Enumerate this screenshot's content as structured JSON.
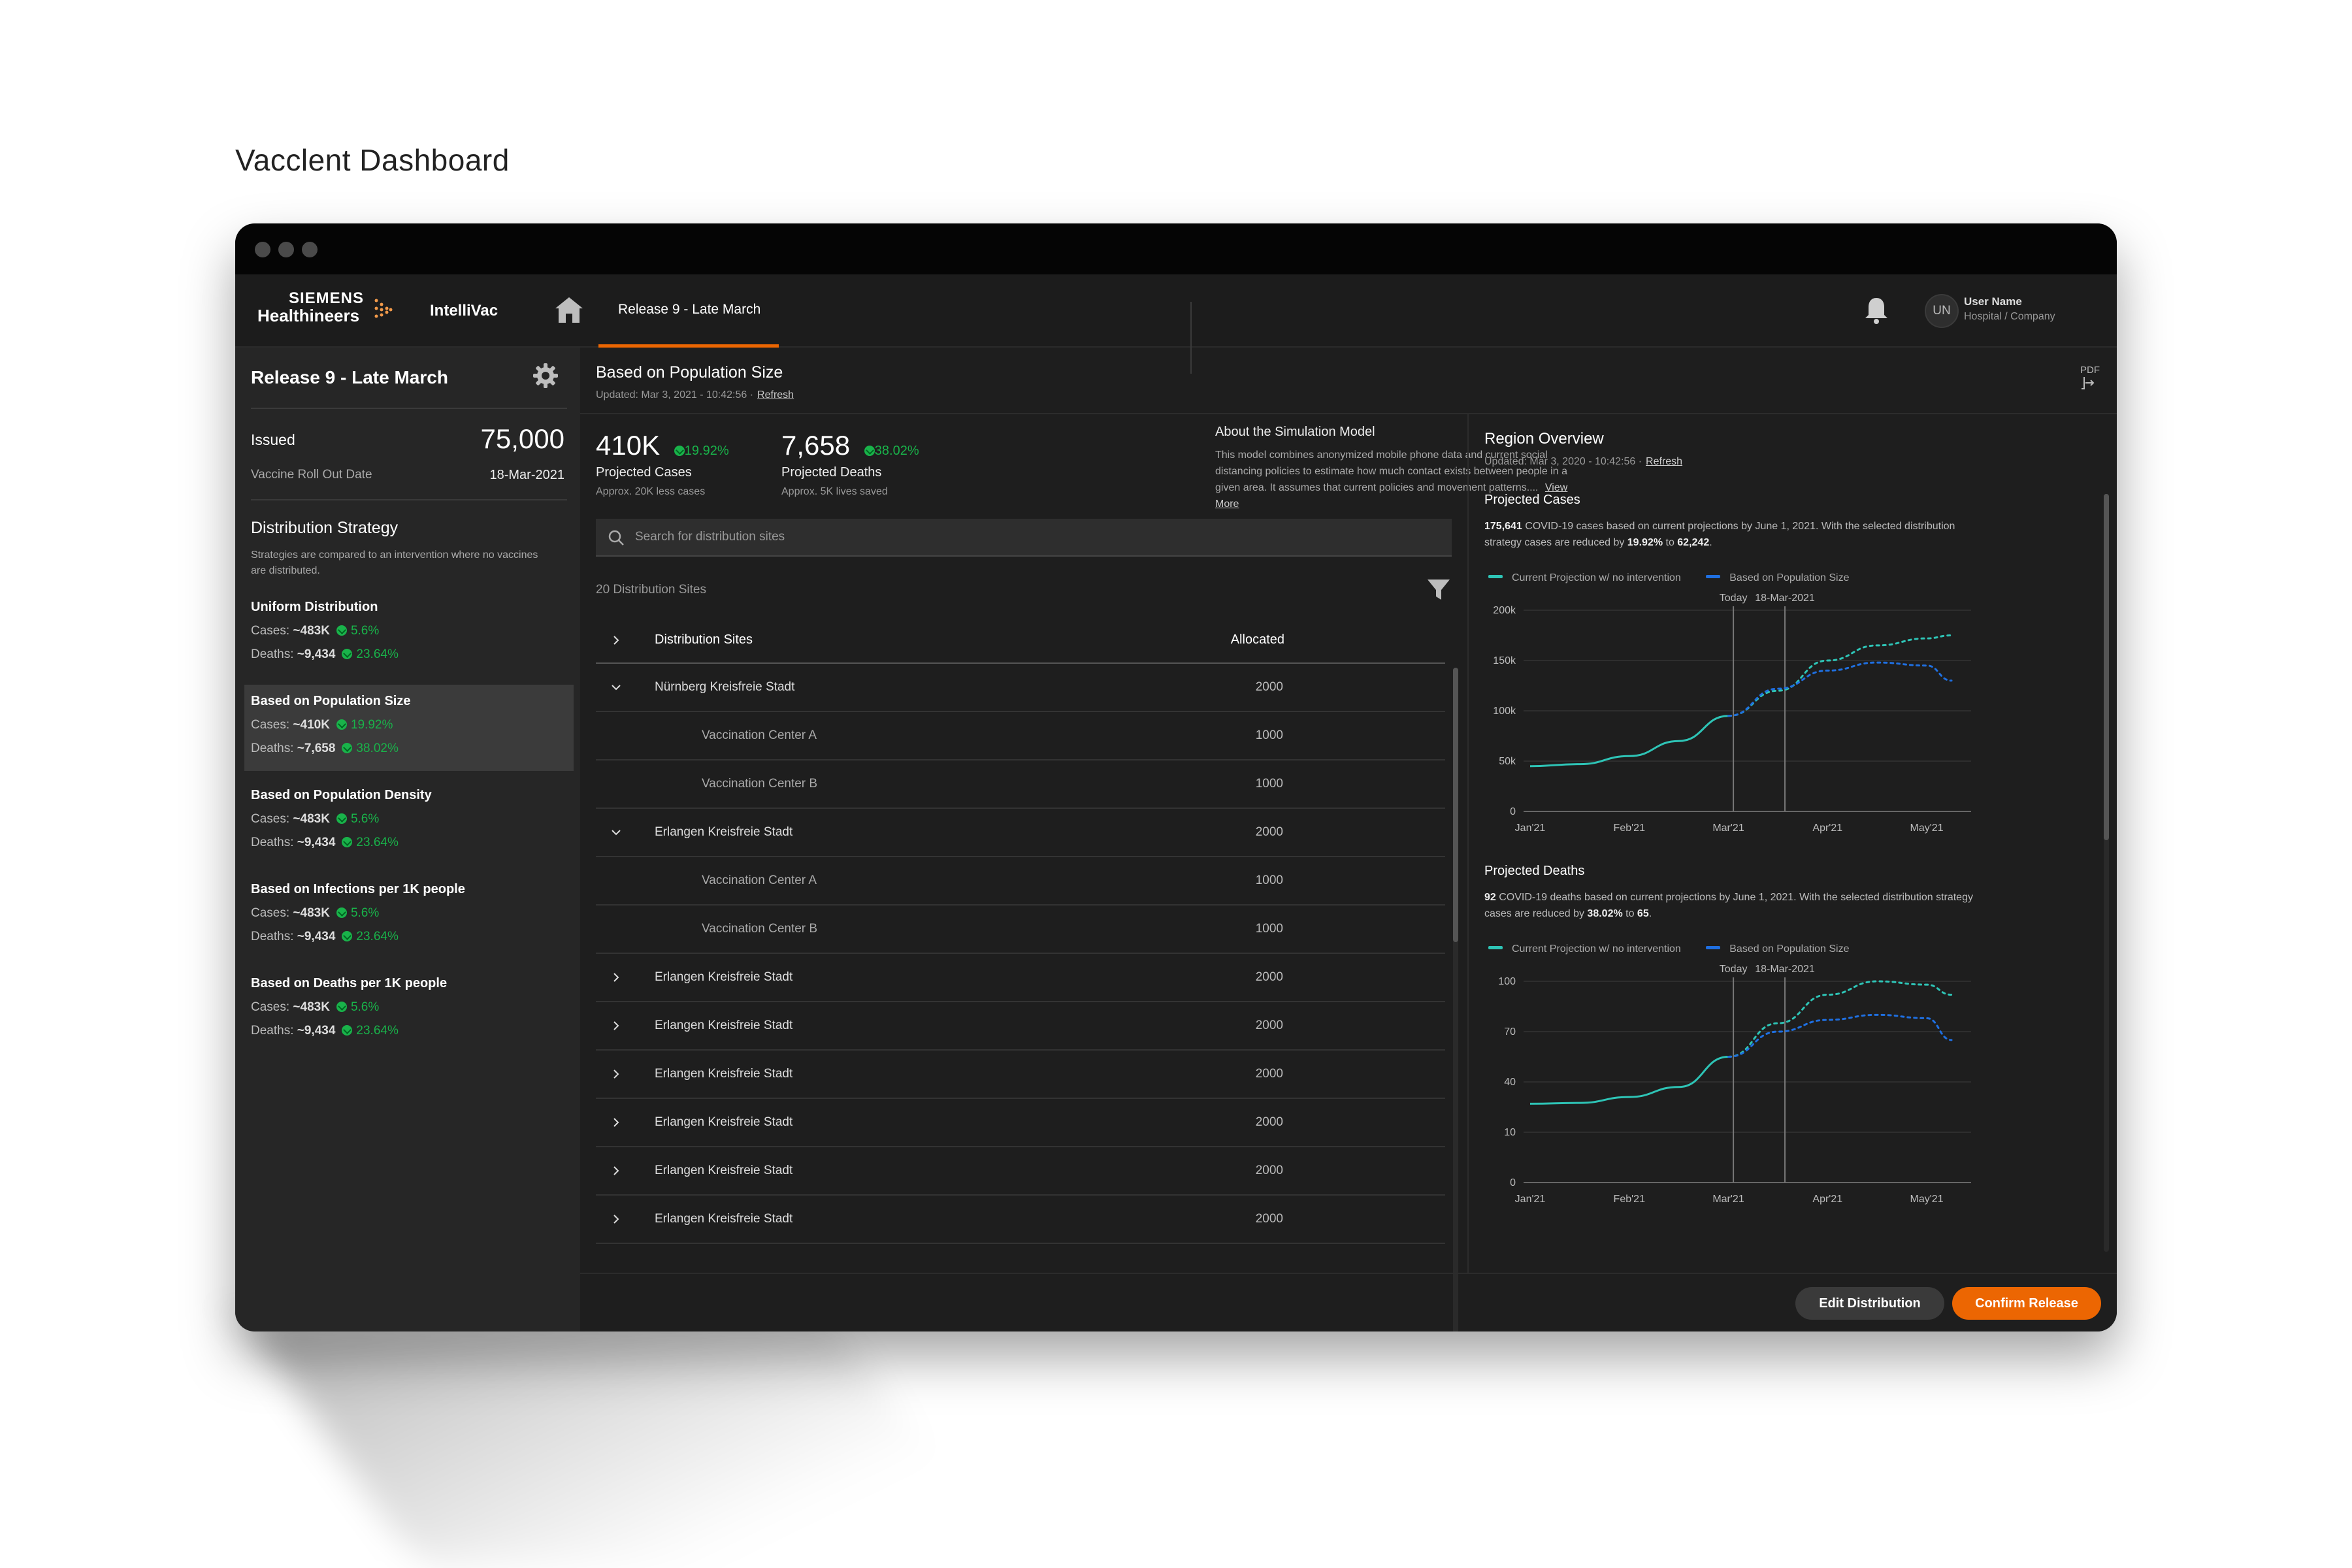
{
  "page_title": "Vacclent Dashboard",
  "nav": {
    "brand_line1": "SIEMENS",
    "brand_line2": "Healthineers",
    "product": "IntelliVac",
    "active_tab": "Release 9 - Late March",
    "user_initials": "UN",
    "user_name": "User Name",
    "user_org": "Hospital / Company",
    "accent_color": "#ec6602"
  },
  "sidebar": {
    "title": "Release 9 - Late March",
    "issued_label": "Issued",
    "issued_value": "75,000",
    "rollout_label": "Vaccine Roll Out Date",
    "rollout_value": "18-Mar-2021",
    "strategy_title": "Distribution Strategy",
    "strategy_desc": "Strategies are compared to an intervention where no vaccines are distributed.",
    "strategies": [
      {
        "name": "Uniform Distribution",
        "cases_label": "Cases:",
        "cases": "~483K",
        "cases_pct": "5.6%",
        "deaths_label": "Deaths:",
        "deaths": "~9,434",
        "deaths_pct": "23.64%"
      },
      {
        "name": "Based on Population Size",
        "cases_label": "Cases:",
        "cases": "~410K",
        "cases_pct": "19.92%",
        "deaths_label": "Deaths:",
        "deaths": "~7,658",
        "deaths_pct": "38.02%"
      },
      {
        "name": "Based on Population Density",
        "cases_label": "Cases:",
        "cases": "~483K",
        "cases_pct": "5.6%",
        "deaths_label": "Deaths:",
        "deaths": "~9,434",
        "deaths_pct": "23.64%"
      },
      {
        "name": "Based on Infections per 1K people",
        "cases_label": "Cases:",
        "cases": "~483K",
        "cases_pct": "5.6%",
        "deaths_label": "Deaths:",
        "deaths": "~9,434",
        "deaths_pct": "23.64%"
      },
      {
        "name": "Based on Deaths per 1K people",
        "cases_label": "Cases:",
        "cases": "~483K",
        "cases_pct": "5.6%",
        "deaths_label": "Deaths:",
        "deaths": "~9,434",
        "deaths_pct": "23.64%"
      }
    ],
    "selected_index": 1
  },
  "main": {
    "title": "Based on Population Size",
    "updated": "Updated: Mar 3, 2021 - 10:42:56 ·",
    "refresh": "Refresh",
    "pdf_label": "PDF",
    "kpis": [
      {
        "value": "410K",
        "pct": "19.92%",
        "label": "Projected Cases",
        "sub": "Approx. 20K less cases"
      },
      {
        "value": "7,658",
        "pct": "38.02%",
        "label": "Projected Deaths",
        "sub": "Approx. 5K lives saved"
      }
    ],
    "about_title": "About the Simulation Model",
    "about_text": "This model combines anonymized mobile phone data and current social distancing policies to estimate how much contact exists between people in a given area. It assumes that current policies and movement patterns....",
    "view_more": "View More",
    "search_placeholder": "Search for distribution sites",
    "sites_count": "20 Distribution Sites",
    "table": {
      "col_site": "Distribution Sites",
      "col_alloc": "Allocated",
      "rows": [
        {
          "name": "Nürnberg Kreisfreie Stadt",
          "value": "2000"
        },
        {
          "name": "Vaccination Center A",
          "value": "1000"
        },
        {
          "name": "Vaccination Center B",
          "value": "1000"
        },
        {
          "name": "Erlangen Kreisfreie Stadt",
          "value": "2000"
        },
        {
          "name": "Vaccination Center A",
          "value": "1000"
        },
        {
          "name": "Vaccination Center B",
          "value": "1000"
        },
        {
          "name": "Erlangen Kreisfreie Stadt",
          "value": "2000"
        },
        {
          "name": "Erlangen Kreisfreie Stadt",
          "value": "2000"
        },
        {
          "name": "Erlangen Kreisfreie Stadt",
          "value": "2000"
        },
        {
          "name": "Erlangen Kreisfreie Stadt",
          "value": "2000"
        },
        {
          "name": "Erlangen Kreisfreie Stadt",
          "value": "2000"
        },
        {
          "name": "Erlangen Kreisfreie Stadt",
          "value": "2000"
        }
      ]
    }
  },
  "region": {
    "title": "Region Overview",
    "updated": "Updated: Mar 3, 2020 - 10:42:56 ·",
    "refresh": "Refresh",
    "cases": {
      "title": "Projected Cases",
      "desc_bold1": "175,641",
      "desc_mid": " COVID-19 cases based on current projections by June 1, 2021. With the selected distribution strategy cases are reduced by ",
      "desc_bold2": "19.92%",
      "desc_to": " to ",
      "desc_bold3": "62,242",
      "desc_end": "."
    },
    "deaths": {
      "title": "Projected Deaths",
      "desc_bold1": "92",
      "desc_mid": " COVID-19 deaths based on current projections by June 1, 2021. With the selected distribution strategy cases are reduced by ",
      "desc_bold2": "38.02%",
      "desc_to": " to ",
      "desc_bold3": "65",
      "desc_end": "."
    },
    "legend_current": "Current Projection  w/ no intervention",
    "legend_based": "Based on Population Size",
    "color_current": "#2ec4b6",
    "color_based": "#1f6fe0"
  },
  "buttons": {
    "edit": "Edit Distribution",
    "confirm": "Confirm Release"
  },
  "chart_data": [
    {
      "type": "line",
      "title": "Projected Cases",
      "x_ticks": [
        "Jan'21",
        "Feb'21",
        "Mar'21",
        "Apr'21",
        "May'21"
      ],
      "y_ticks": [
        "0",
        "50k",
        "100k",
        "150k",
        "200k"
      ],
      "ylim": [
        0,
        200000
      ],
      "markers": [
        {
          "label": "Today",
          "x": 2.05
        },
        {
          "label": "18-Mar-2021",
          "x": 2.57
        }
      ],
      "series": [
        {
          "name": "Current Projection  w/ no intervention",
          "style": "solid",
          "x": [
            0,
            0.5,
            1,
            1.5,
            2
          ],
          "values": [
            45000,
            47000,
            55000,
            70000,
            95000
          ]
        },
        {
          "name": "Current Projection  w/ no intervention",
          "style": "dotted",
          "x": [
            2,
            2.5,
            3,
            3.5,
            4,
            4.25
          ],
          "values": [
            95000,
            120000,
            150000,
            165000,
            172000,
            175000
          ]
        },
        {
          "name": "Based on Population Size",
          "style": "dotted",
          "x": [
            2,
            2.5,
            3,
            3.5,
            4,
            4.25
          ],
          "values": [
            95000,
            122000,
            140000,
            148000,
            145000,
            130000
          ]
        }
      ]
    },
    {
      "type": "line",
      "title": "Projected Deaths",
      "x_ticks": [
        "Jan'21",
        "Feb'21",
        "Mar'21",
        "Apr'21",
        "May'21"
      ],
      "y_ticks": [
        "0",
        "10",
        "40",
        "70",
        "100"
      ],
      "markers": [
        {
          "label": "Today",
          "x": 2.05
        },
        {
          "label": "18-Mar-2021",
          "x": 2.57
        }
      ],
      "series": [
        {
          "name": "Current Projection  w/ no intervention",
          "style": "solid",
          "x": [
            0,
            0.5,
            1,
            1.5,
            2
          ],
          "values": [
            27,
            27.5,
            31,
            37,
            55
          ]
        },
        {
          "name": "Current Projection  w/ no intervention",
          "style": "dotted",
          "x": [
            2,
            2.5,
            3,
            3.5,
            4,
            4.25
          ],
          "values": [
            55,
            75,
            92,
            100,
            98,
            92
          ]
        },
        {
          "name": "Based on Population Size",
          "style": "dotted",
          "x": [
            2,
            2.5,
            3,
            3.5,
            4,
            4.25
          ],
          "values": [
            55,
            70,
            77,
            80,
            78,
            65
          ]
        }
      ]
    }
  ]
}
